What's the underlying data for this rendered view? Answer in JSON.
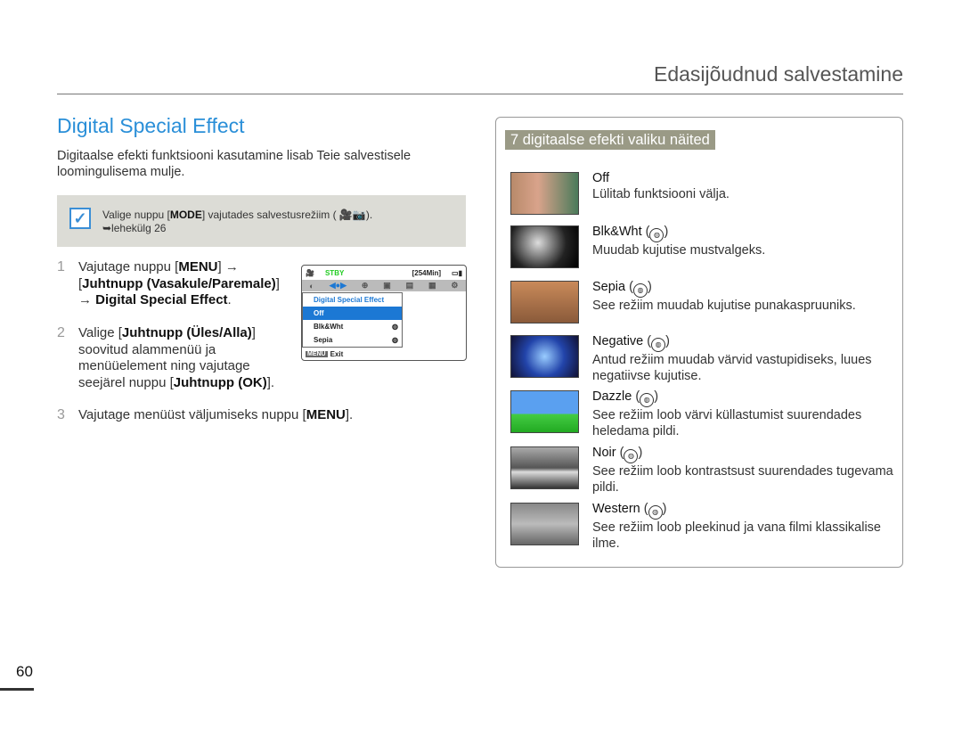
{
  "header": {
    "title": "Edasijõudnud salvestamine"
  },
  "section_title": "Digital Special Effect",
  "intro": "Digitaalse efekti funktsiooni kasutamine lisab Teie salvestisele loomingulisema mulje.",
  "note": {
    "icon": "checkbox-icon",
    "line1_pre": "Valige nuppu [",
    "line1_bold": "MODE",
    "line1_post": "] vajutades salvestusrežiim (",
    "line1_end": ").",
    "line2": "➥lehekülg 26"
  },
  "steps": [
    {
      "num": "1",
      "a": "Vajutage nuppu [",
      "b": "MENU",
      "c": "] →",
      "d": "[",
      "e": "Juhtnupp (Vasakule/Paremale)",
      "f": "]",
      "g": "→ ",
      "h": "Digital Special Effect",
      "i": "."
    },
    {
      "num": "2",
      "a": "Valige [",
      "b": "Juhtnupp (Üles/Alla)",
      "c": "]",
      "d": "soovitud alammenüü ja",
      "e": "menüüelement ning vajutage",
      "f": "seejärel nuppu [",
      "g": "Juhtnupp (OK)",
      "h": "]."
    },
    {
      "num": "3",
      "a": "Vajutage menüüst väljumiseks nuppu [",
      "b": "MENU",
      "c": "]."
    }
  ],
  "lcd": {
    "status": "STBY",
    "remaining": "[254Min]",
    "menu_title": "Digital Special Effect",
    "options": [
      "Off",
      "Blk&Wht",
      "Sepia"
    ],
    "selected": "Off",
    "menu_key": "MENU",
    "exit": "Exit"
  },
  "panel": {
    "title": "7 digitaalse efekti valiku näited",
    "items": [
      {
        "name": "Off",
        "desc": "Lülitab funktsiooni välja.",
        "icon": ""
      },
      {
        "name": "Blk&Wht",
        "desc": "Muudab kujutise mustvalgeks.",
        "icon": "bw-icon"
      },
      {
        "name": "Sepia",
        "desc": "See režiim muudab kujutise punakaspruuniks.",
        "icon": "sepia-icon"
      },
      {
        "name": "Negative",
        "desc": "Antud režiim muudab värvid vastupidiseks, luues negatiivse kujutise.",
        "icon": "negative-icon"
      },
      {
        "name": "Dazzle",
        "desc": "See režiim loob värvi küllastumist suurendades heledama pildi.",
        "icon": "dazzle-icon"
      },
      {
        "name": "Noir",
        "desc": "See režiim loob kontrastsust suurendades tugevama pildi.",
        "icon": "noir-icon"
      },
      {
        "name": "Western",
        "desc": "See režiim loob pleekinud ja vana filmi klassikalise ilme.",
        "icon": "western-icon"
      }
    ]
  },
  "page_number": "60"
}
